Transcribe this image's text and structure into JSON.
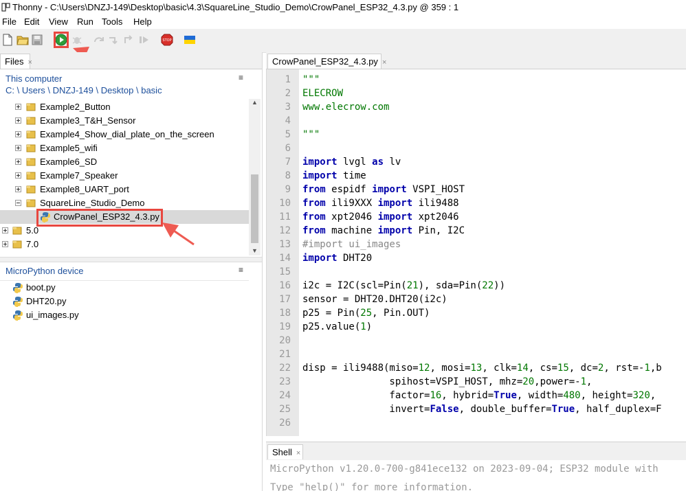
{
  "window": {
    "title": "Thonny  -  C:\\Users\\DNZJ-149\\Desktop\\basic\\4.3\\SquareLine_Studio_Demo\\CrowPanel_ESP32_4.3.py  @  359 : 1"
  },
  "menu": [
    "File",
    "Edit",
    "View",
    "Run",
    "Tools",
    "Help"
  ],
  "toolbar": {
    "icons": [
      "new-file-icon",
      "open-file-icon",
      "save-icon",
      "run-icon",
      "debug-icon",
      "step-over-icon",
      "step-into-icon",
      "step-out-icon",
      "resume-icon",
      "stop-icon",
      "ukraine-flag-icon"
    ]
  },
  "files_panel": {
    "tab_label": "Files",
    "tab_close": "×",
    "this_computer_title": "This computer",
    "path": "C: \\ Users \\ DNZJ-149 \\ Desktop \\ basic",
    "menu_glyph": "≡",
    "tree": [
      {
        "label": "Example2_Button",
        "type": "folder",
        "state": "collapsed"
      },
      {
        "label": "Example3_T&H_Sensor",
        "type": "folder",
        "state": "collapsed"
      },
      {
        "label": "Example4_Show_dial_plate_on_the_screen",
        "type": "folder",
        "state": "collapsed"
      },
      {
        "label": "Example5_wifi",
        "type": "folder",
        "state": "collapsed"
      },
      {
        "label": "Example6_SD",
        "type": "folder",
        "state": "collapsed"
      },
      {
        "label": "Example7_Speaker",
        "type": "folder",
        "state": "collapsed"
      },
      {
        "label": "Example8_UART_port",
        "type": "folder",
        "state": "collapsed"
      },
      {
        "label": "SquareLine_Studio_Demo",
        "type": "folder",
        "state": "expanded"
      },
      {
        "label": "CrowPanel_ESP32_4.3.py",
        "type": "python-file",
        "state": "selected"
      },
      {
        "label": "5.0",
        "type": "folder",
        "state": "collapsed"
      },
      {
        "label": "7.0",
        "type": "folder",
        "state": "collapsed"
      }
    ],
    "device_title": "MicroPython device",
    "device_files": [
      "boot.py",
      "DHT20.py",
      "ui_images.py"
    ]
  },
  "editor": {
    "tab_label": "CrowPanel_ESP32_4.3.py",
    "tab_close": "×",
    "line_numbers": [
      "1",
      "2",
      "3",
      "4",
      "5",
      "6",
      "7",
      "8",
      "9",
      "10",
      "11",
      "12",
      "13",
      "14",
      "15",
      "16",
      "17",
      "18",
      "19",
      "20",
      "21",
      "22",
      "23",
      "24",
      "25",
      "26"
    ],
    "lines": {
      "l1": "\"\"\"",
      "l2": "ELECROW",
      "l3": "www.elecrow.com",
      "l5": "\"\"\"",
      "l7_kw1": "import",
      "l7_a": " lvgl ",
      "l7_kw2": "as",
      "l7_b": " lv",
      "l8_kw": "import",
      "l8_a": " time",
      "l9_kw1": "from",
      "l9_a": " espidf ",
      "l9_kw2": "import",
      "l9_b": " VSPI_HOST",
      "l10_kw1": "from",
      "l10_a": " ili9XXX ",
      "l10_kw2": "import",
      "l10_b": " ili9488",
      "l11_kw1": "from",
      "l11_a": " xpt2046 ",
      "l11_kw2": "import",
      "l11_b": " xpt2046",
      "l12_kw1": "from",
      "l12_a": " machine ",
      "l12_kw2": "import",
      "l12_b": " Pin, I2C",
      "l13": "#import ui_images",
      "l14_kw": "import",
      "l14_a": " DHT20",
      "l16_a": "i2c = I2C(scl=Pin(",
      "l16_n1": "21",
      "l16_b": "), sda=Pin(",
      "l16_n2": "22",
      "l16_c": "))",
      "l17": "sensor = DHT20.DHT20(i2c)",
      "l18_a": "p25 = Pin(",
      "l18_n": "25",
      "l18_b": ", Pin.OUT)",
      "l19_a": "p25.value(",
      "l19_n": "1",
      "l19_b": ")",
      "l22_a": "disp = ili9488(miso=",
      "l22_n1": "12",
      "l22_b": ", mosi=",
      "l22_n2": "13",
      "l22_c": ", clk=",
      "l22_n3": "14",
      "l22_d": ", cs=",
      "l22_n4": "15",
      "l22_e": ", dc=",
      "l22_n5": "2",
      "l22_f": ", rst=-",
      "l22_n6": "1",
      "l22_g": ",b",
      "l23_a": "               spihost=VSPI_HOST, mhz=",
      "l23_n1": "20",
      "l23_b": ",power=-",
      "l23_n2": "1",
      "l23_c": ",",
      "l24_a": "               factor=",
      "l24_n1": "16",
      "l24_b": ", hybrid=",
      "l24_kw": "True",
      "l24_c": ", width=",
      "l24_n2": "480",
      "l24_d": ", height=",
      "l24_n3": "320",
      "l24_e": ",",
      "l25_a": "               invert=",
      "l25_kw1": "False",
      "l25_b": ", double_buffer=",
      "l25_kw2": "True",
      "l25_c": ", half_duplex=F"
    }
  },
  "shell": {
    "tab_label": "Shell",
    "tab_close": "×",
    "line1": "MicroPython v1.20.0-700-g841ece132 on 2023-09-04; ESP32 module with",
    "line2": "Type \"help()\" for more information."
  }
}
